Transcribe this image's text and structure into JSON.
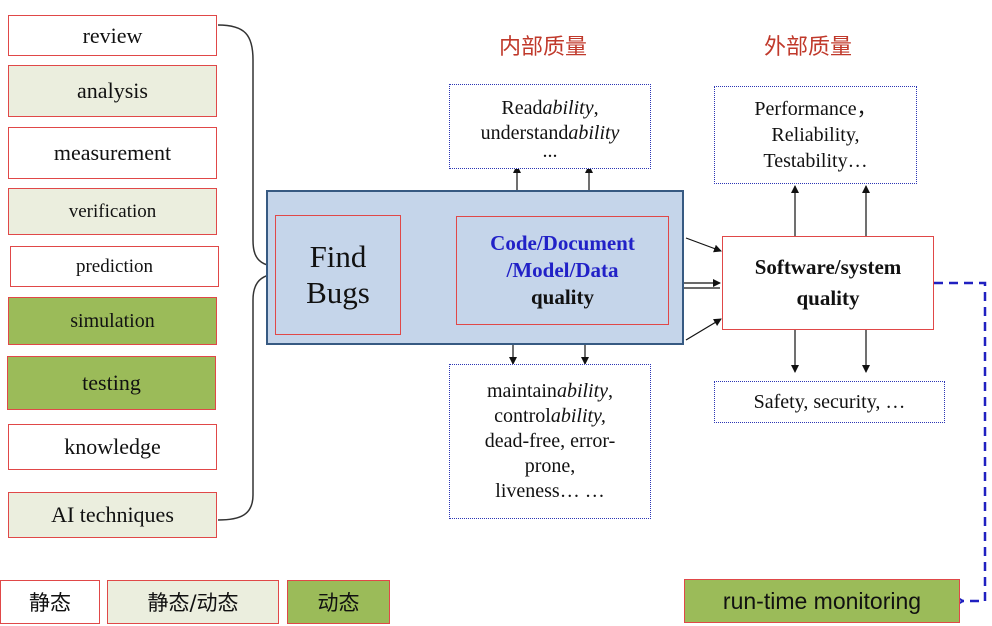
{
  "methods": {
    "review": "review",
    "analysis": "analysis",
    "measurement": "measurement",
    "verification": "verification",
    "prediction": "prediction",
    "simulation": "simulation",
    "testing": "testing",
    "knowledge": "knowledge",
    "ai_techniques": "AI techniques"
  },
  "headings": {
    "internal_quality": "内部质量",
    "external_quality": "外部质量"
  },
  "center": {
    "find_bugs_line1": "Find",
    "find_bugs_line2": "Bugs",
    "code_line1": "Code/Document",
    "code_line2": "/Model/Data",
    "code_line3": "quality"
  },
  "internal_top": {
    "read_prefix": "Read",
    "read_italic": "ability",
    "read_suffix": ",",
    "understand_prefix": "understand",
    "understand_italic": "ability",
    "ellipsis": "..."
  },
  "internal_bottom": {
    "maintain_prefix": "maintain",
    "maintain_italic": "ability",
    "maintain_suffix": ",",
    "control_prefix": "control",
    "control_italic": "ability,",
    "line3": "dead-free, error-",
    "line4": "prone,",
    "line5": "liveness… …"
  },
  "external_top": {
    "line1": "Performance，",
    "line2": "Reliability,",
    "line3": "Testability…"
  },
  "system": {
    "line1": "Software/system",
    "line2": "quality"
  },
  "external_bottom": {
    "text": "Safety, security, …"
  },
  "legend": {
    "static": "静态",
    "static_dynamic": "静态/动态",
    "dynamic": "动态"
  },
  "runtime": "run-time monitoring",
  "colors": {
    "box_border": "#e04848",
    "light_fill": "#ebeede",
    "green_fill": "#9bbb59",
    "panel_fill": "#c5d5ea",
    "panel_border": "#375a82",
    "blue_text": "#2121c7",
    "heading_red": "#c0392b",
    "dotted_border": "#2c35b5",
    "dashed_line": "#2020c0"
  }
}
